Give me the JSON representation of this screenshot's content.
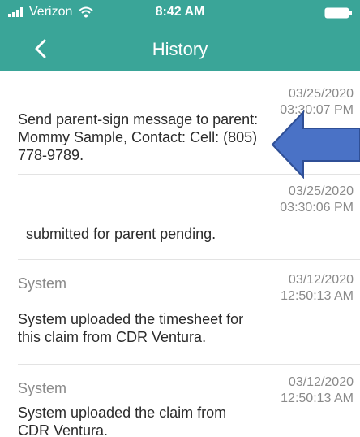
{
  "status_bar": {
    "carrier": "Verizon",
    "time": "8:42 AM"
  },
  "header": {
    "title": "History",
    "back_icon": "chevron-left-icon"
  },
  "colors": {
    "header_bg": "#3aa598",
    "arrow_fill": "#4a72c6",
    "arrow_stroke": "#2f4f96"
  },
  "history": {
    "entries": [
      {
        "source": "",
        "date": "03/25/2020",
        "time": "03:30:07 PM",
        "message": "Send parent-sign message to parent: Mommy Sample, Contact: Cell: (805) 778-9789."
      },
      {
        "source": "",
        "date": "03/25/2020",
        "time": "03:30:06 PM",
        "message": "submitted for parent pending."
      },
      {
        "source": "System",
        "date": "03/12/2020",
        "time": "12:50:13 AM",
        "message": "System uploaded the timesheet for this claim from CDR Ventura."
      },
      {
        "source": "System",
        "date": "03/12/2020",
        "time": "12:50:13 AM",
        "message": "System uploaded the claim from CDR Ventura."
      }
    ]
  }
}
